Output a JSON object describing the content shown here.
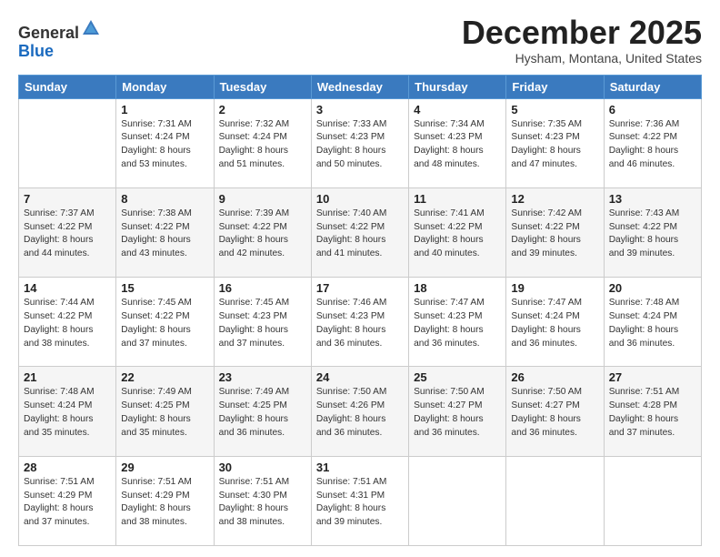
{
  "logo": {
    "general": "General",
    "blue": "Blue"
  },
  "header": {
    "title": "December 2025",
    "location": "Hysham, Montana, United States"
  },
  "weekdays": [
    "Sunday",
    "Monday",
    "Tuesday",
    "Wednesday",
    "Thursday",
    "Friday",
    "Saturday"
  ],
  "weeks": [
    [
      {
        "day": "",
        "info": ""
      },
      {
        "day": "1",
        "info": "Sunrise: 7:31 AM\nSunset: 4:24 PM\nDaylight: 8 hours\nand 53 minutes."
      },
      {
        "day": "2",
        "info": "Sunrise: 7:32 AM\nSunset: 4:24 PM\nDaylight: 8 hours\nand 51 minutes."
      },
      {
        "day": "3",
        "info": "Sunrise: 7:33 AM\nSunset: 4:23 PM\nDaylight: 8 hours\nand 50 minutes."
      },
      {
        "day": "4",
        "info": "Sunrise: 7:34 AM\nSunset: 4:23 PM\nDaylight: 8 hours\nand 48 minutes."
      },
      {
        "day": "5",
        "info": "Sunrise: 7:35 AM\nSunset: 4:23 PM\nDaylight: 8 hours\nand 47 minutes."
      },
      {
        "day": "6",
        "info": "Sunrise: 7:36 AM\nSunset: 4:22 PM\nDaylight: 8 hours\nand 46 minutes."
      }
    ],
    [
      {
        "day": "7",
        "info": "Sunrise: 7:37 AM\nSunset: 4:22 PM\nDaylight: 8 hours\nand 44 minutes."
      },
      {
        "day": "8",
        "info": "Sunrise: 7:38 AM\nSunset: 4:22 PM\nDaylight: 8 hours\nand 43 minutes."
      },
      {
        "day": "9",
        "info": "Sunrise: 7:39 AM\nSunset: 4:22 PM\nDaylight: 8 hours\nand 42 minutes."
      },
      {
        "day": "10",
        "info": "Sunrise: 7:40 AM\nSunset: 4:22 PM\nDaylight: 8 hours\nand 41 minutes."
      },
      {
        "day": "11",
        "info": "Sunrise: 7:41 AM\nSunset: 4:22 PM\nDaylight: 8 hours\nand 40 minutes."
      },
      {
        "day": "12",
        "info": "Sunrise: 7:42 AM\nSunset: 4:22 PM\nDaylight: 8 hours\nand 39 minutes."
      },
      {
        "day": "13",
        "info": "Sunrise: 7:43 AM\nSunset: 4:22 PM\nDaylight: 8 hours\nand 39 minutes."
      }
    ],
    [
      {
        "day": "14",
        "info": "Sunrise: 7:44 AM\nSunset: 4:22 PM\nDaylight: 8 hours\nand 38 minutes."
      },
      {
        "day": "15",
        "info": "Sunrise: 7:45 AM\nSunset: 4:22 PM\nDaylight: 8 hours\nand 37 minutes."
      },
      {
        "day": "16",
        "info": "Sunrise: 7:45 AM\nSunset: 4:23 PM\nDaylight: 8 hours\nand 37 minutes."
      },
      {
        "day": "17",
        "info": "Sunrise: 7:46 AM\nSunset: 4:23 PM\nDaylight: 8 hours\nand 36 minutes."
      },
      {
        "day": "18",
        "info": "Sunrise: 7:47 AM\nSunset: 4:23 PM\nDaylight: 8 hours\nand 36 minutes."
      },
      {
        "day": "19",
        "info": "Sunrise: 7:47 AM\nSunset: 4:24 PM\nDaylight: 8 hours\nand 36 minutes."
      },
      {
        "day": "20",
        "info": "Sunrise: 7:48 AM\nSunset: 4:24 PM\nDaylight: 8 hours\nand 36 minutes."
      }
    ],
    [
      {
        "day": "21",
        "info": "Sunrise: 7:48 AM\nSunset: 4:24 PM\nDaylight: 8 hours\nand 35 minutes."
      },
      {
        "day": "22",
        "info": "Sunrise: 7:49 AM\nSunset: 4:25 PM\nDaylight: 8 hours\nand 35 minutes."
      },
      {
        "day": "23",
        "info": "Sunrise: 7:49 AM\nSunset: 4:25 PM\nDaylight: 8 hours\nand 36 minutes."
      },
      {
        "day": "24",
        "info": "Sunrise: 7:50 AM\nSunset: 4:26 PM\nDaylight: 8 hours\nand 36 minutes."
      },
      {
        "day": "25",
        "info": "Sunrise: 7:50 AM\nSunset: 4:27 PM\nDaylight: 8 hours\nand 36 minutes."
      },
      {
        "day": "26",
        "info": "Sunrise: 7:50 AM\nSunset: 4:27 PM\nDaylight: 8 hours\nand 36 minutes."
      },
      {
        "day": "27",
        "info": "Sunrise: 7:51 AM\nSunset: 4:28 PM\nDaylight: 8 hours\nand 37 minutes."
      }
    ],
    [
      {
        "day": "28",
        "info": "Sunrise: 7:51 AM\nSunset: 4:29 PM\nDaylight: 8 hours\nand 37 minutes."
      },
      {
        "day": "29",
        "info": "Sunrise: 7:51 AM\nSunset: 4:29 PM\nDaylight: 8 hours\nand 38 minutes."
      },
      {
        "day": "30",
        "info": "Sunrise: 7:51 AM\nSunset: 4:30 PM\nDaylight: 8 hours\nand 38 minutes."
      },
      {
        "day": "31",
        "info": "Sunrise: 7:51 AM\nSunset: 4:31 PM\nDaylight: 8 hours\nand 39 minutes."
      },
      {
        "day": "",
        "info": ""
      },
      {
        "day": "",
        "info": ""
      },
      {
        "day": "",
        "info": ""
      }
    ]
  ]
}
